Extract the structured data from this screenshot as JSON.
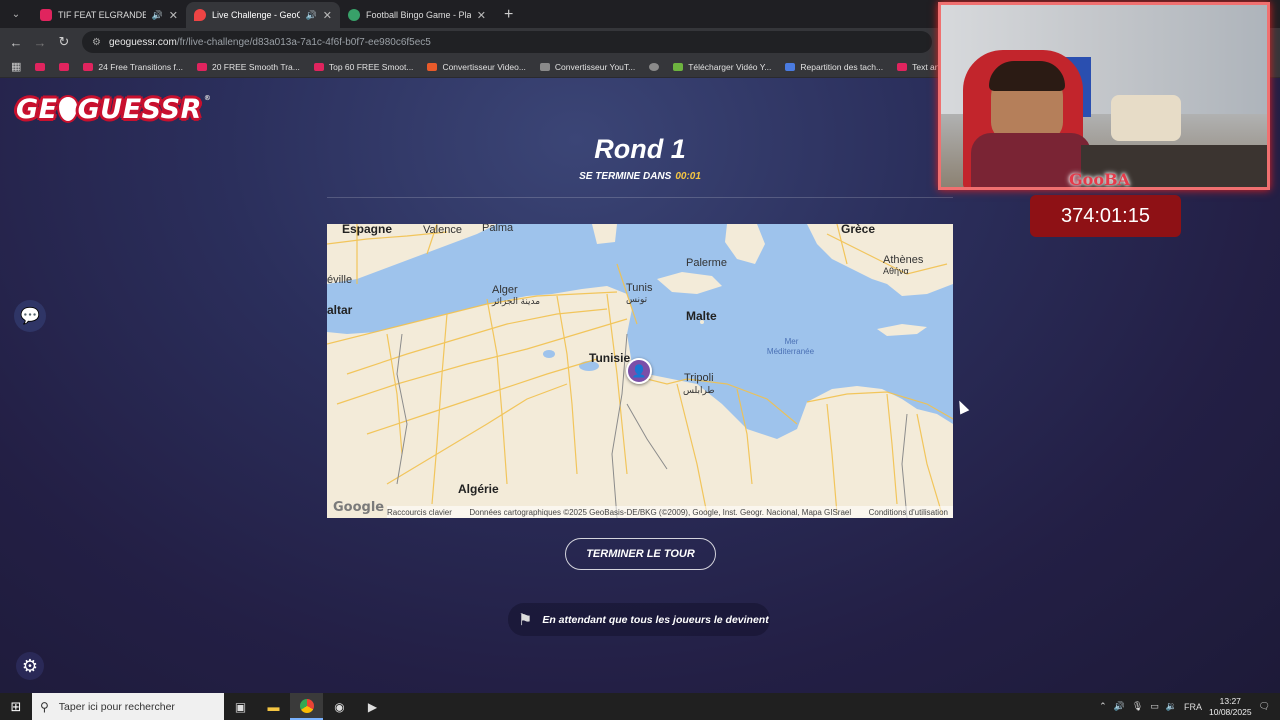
{
  "browser": {
    "tabs": [
      {
        "title": "TIF FEAT ELGRANDETOTO -",
        "favicon_color": "#e0245e",
        "has_sound": true,
        "active": false
      },
      {
        "title": "Live Challenge - GeoGuessr",
        "favicon_color": "#ef4444",
        "has_sound": true,
        "active": true
      },
      {
        "title": "Football Bingo Game - Play No",
        "favicon_color": "#38a169",
        "has_sound": false,
        "active": false
      }
    ],
    "url_host": "geoguessr.com",
    "url_path": "/fr/live-challenge/d83a013a-7a1c-4f6f-b0f7-ee980c6f5ec5",
    "bookmarks": [
      {
        "label": "",
        "color": "#e0245e"
      },
      {
        "label": "",
        "color": "#e0245e"
      },
      {
        "label": "24 Free Transitions f...",
        "color": "#e0245e"
      },
      {
        "label": "20 FREE Smooth Tra...",
        "color": "#e0245e"
      },
      {
        "label": "Top 60 FREE Smoot...",
        "color": "#e0245e"
      },
      {
        "label": "Convertisseur Video...",
        "color": "#e85a2a"
      },
      {
        "label": "Convertisseur YouT...",
        "color": "#8a8a8a"
      },
      {
        "label": "",
        "color": "#8a8a8a"
      },
      {
        "label": "Télécharger Vidéo Y...",
        "color": "#6db33f"
      },
      {
        "label": "Repartition des tach...",
        "color": "#4a7be0"
      },
      {
        "label": "Text and Image ani...",
        "color": "#e0245e"
      }
    ]
  },
  "game": {
    "logo": "GE   GUESSR",
    "logo_reg": "®",
    "round_title": "Rond 1",
    "timer_label": "SE TERMINE DANS",
    "timer_value": "00:01",
    "finish_button": "TERMINER LE TOUR",
    "waiting_text": "En attendant que tous les joueurs le devinent"
  },
  "map": {
    "labels": {
      "espagne": "Espagne",
      "valence": "Valence",
      "palma": "Palma",
      "grece": "Grèce",
      "palerme": "Palerme",
      "athenes": "Athènes",
      "athenes_gr": "Αθήνα",
      "seville": "éville",
      "alger": "Alger",
      "alger_ar": "مدينة الجزائر",
      "tunis": "Tunis",
      "tunis_ar": "تونس",
      "altar": "altar",
      "malte": "Malte",
      "mer": "Mer",
      "mediterranee": "Méditerranée",
      "tunisie": "Tunisie",
      "tripoli": "Tripoli",
      "tripoli_ar": "طرابلس",
      "algerie": "Algérie"
    },
    "google": "Google",
    "shortcuts": "Raccourcis clavier",
    "copyright": "Données cartographiques ©2025 GeoBasis-DE/BKG (©2009), Google, Inst. Geogr. Nacional, Mapa GISrael",
    "terms": "Conditions d'utilisation"
  },
  "overlay": {
    "webcam_label": "GooBA",
    "stream_timer": "374:01:15"
  },
  "taskbar": {
    "search_placeholder": "Taper ici pour rechercher",
    "language": "FRA",
    "time": "13:27",
    "date": "10/08/2025"
  }
}
